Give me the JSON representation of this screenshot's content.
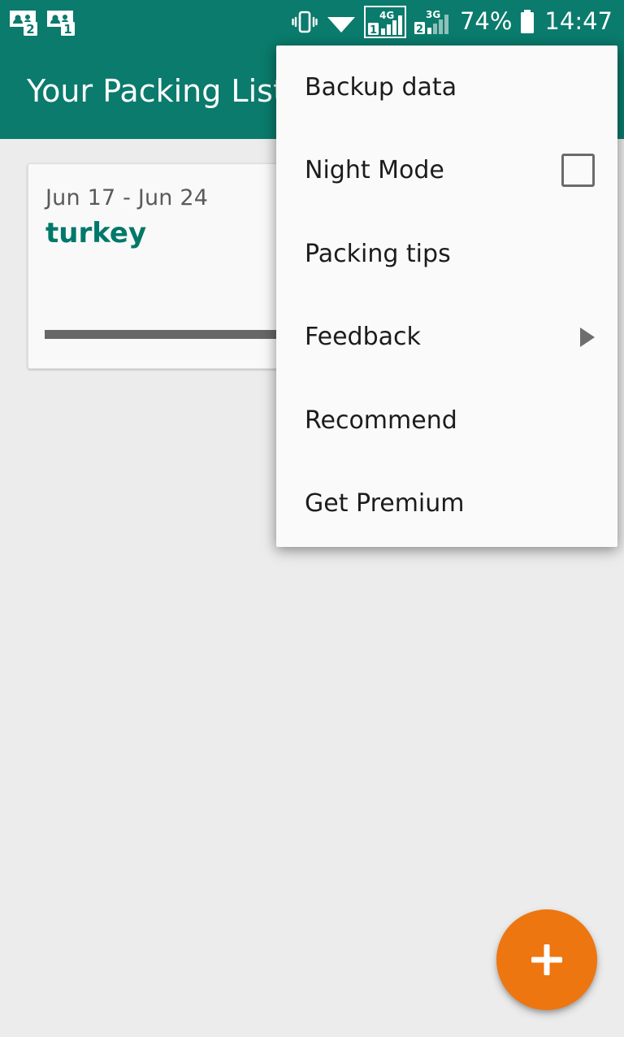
{
  "status_bar": {
    "notifications": [
      {
        "icon": "sim-contact-badge-icon",
        "badge": "2"
      },
      {
        "icon": "sim-contact-badge-icon",
        "badge": "1"
      }
    ],
    "vibrate_icon": "vibrate-icon",
    "wifi_icon": "wifi-icon",
    "sim1": {
      "label": "4G",
      "slot": "1",
      "icon": "signal-bars-icon"
    },
    "sim2": {
      "label": "3G",
      "slot": "2",
      "icon": "signal-bars-icon"
    },
    "battery_percent": "74%",
    "battery_icon": "battery-icon",
    "clock": "14:47",
    "background_color": "#0a7b6c",
    "foreground_color": "#ffffff"
  },
  "app_bar": {
    "title": "Your Packing List",
    "background_color": "#0a7b6c",
    "title_color": "#ffffff"
  },
  "content": {
    "background_color": "#ececec",
    "trip_card": {
      "dates": "Jun 17 - Jun 24",
      "name": "turkey",
      "name_color": "#00786a",
      "dates_color": "#5a5a5a",
      "progress_percent": 100,
      "progress_color": "#676767"
    },
    "fab": {
      "icon": "plus-icon",
      "label": "+",
      "background_color": "#ed7611",
      "icon_color": "#ffffff"
    }
  },
  "popup_menu": {
    "background_color": "#fafafa",
    "items": [
      {
        "label": "Backup data",
        "trailing": "none"
      },
      {
        "label": "Night Mode",
        "trailing": "checkbox",
        "checked": false
      },
      {
        "label": "Packing tips",
        "trailing": "none"
      },
      {
        "label": "Feedback",
        "trailing": "submenu-arrow"
      },
      {
        "label": "Recommend",
        "trailing": "none"
      },
      {
        "label": "Get Premium",
        "trailing": "none"
      }
    ]
  }
}
